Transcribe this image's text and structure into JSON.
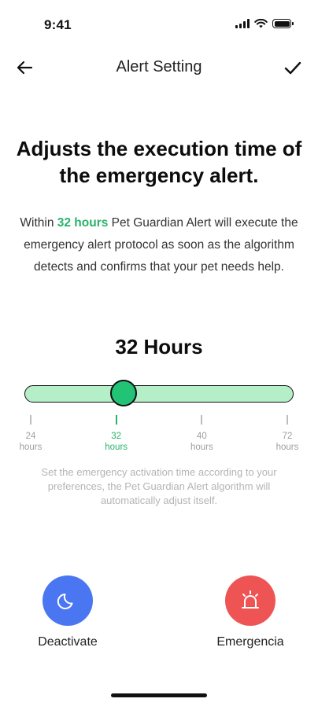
{
  "status_bar": {
    "time": "9:41"
  },
  "nav": {
    "title": "Alert Setting",
    "back_icon": "arrow-left-icon",
    "confirm_icon": "check-icon"
  },
  "headline": "Adjusts the execution time of the emergency alert.",
  "description": {
    "before": "Within ",
    "highlight": "32 hours",
    "after": " Pet Guardian Alert will execute the emergency alert protocol as soon as the algorithm detects and confirms that your pet needs help."
  },
  "slider": {
    "value_label": "32 Hours",
    "selected_hours": 32,
    "ticks": [
      {
        "value": "24",
        "unit": "hours"
      },
      {
        "value": "32",
        "unit": "hours"
      },
      {
        "value": "40",
        "unit": "hours"
      },
      {
        "value": "72",
        "unit": "hours"
      }
    ],
    "selected_index": 1,
    "track_color": "#b5efc8",
    "thumb_color": "#22c374"
  },
  "helper_text": "Set the emergency activation time according to your preferences, the Pet Guardian Alert algorithm will automatically adjust itself.",
  "actions": {
    "deactivate": {
      "label": "Deactivate",
      "icon": "moon-icon",
      "color": "#4a76f2"
    },
    "emergency": {
      "label": "Emergencia",
      "icon": "siren-icon",
      "color": "#ef5454"
    }
  },
  "colors": {
    "accent": "#27b36a"
  }
}
